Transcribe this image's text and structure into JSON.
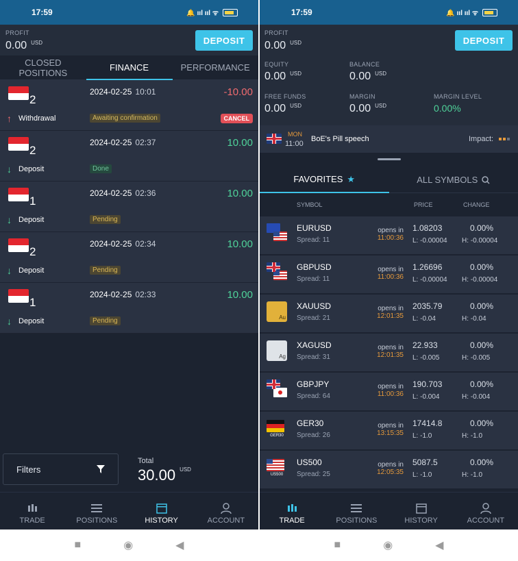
{
  "status": {
    "time": "17:59",
    "icons": "🔔 ııl ııl ᯤ"
  },
  "left": {
    "profit": {
      "label": "PROFIT",
      "value": "0.00",
      "currency": "USD"
    },
    "deposit_btn": "DEPOSIT",
    "tabs": [
      "CLOSED POSITIONS",
      "FINANCE",
      "PERFORMANCE"
    ],
    "rows": [
      {
        "num": "2",
        "date": "2024-02-25",
        "time": "10:01",
        "amount": "-10.00",
        "type": "Withdrawal",
        "status": "Awaiting confirmation",
        "cancel": "CANCEL",
        "amount_color": "#f06b6f"
      },
      {
        "num": "2",
        "date": "2024-02-25",
        "time": "02:37",
        "amount": "10.00",
        "type": "Deposit",
        "status": "Done",
        "amount_color": "#4fd39a"
      },
      {
        "num": "1",
        "date": "2024-02-25",
        "time": "02:36",
        "amount": "10.00",
        "type": "Deposit",
        "status": "Pending",
        "amount_color": "#4fd39a"
      },
      {
        "num": "2",
        "date": "2024-02-25",
        "time": "02:34",
        "amount": "10.00",
        "type": "Deposit",
        "status": "Pending",
        "amount_color": "#4fd39a"
      },
      {
        "num": "1",
        "date": "2024-02-25",
        "time": "02:33",
        "amount": "10.00",
        "type": "Deposit",
        "status": "Pending",
        "amount_color": "#4fd39a"
      }
    ],
    "filters": "Filters",
    "total": {
      "label": "Total",
      "value": "30.00",
      "currency": "USD"
    },
    "nav": [
      "TRADE",
      "POSITIONS",
      "HISTORY",
      "ACCOUNT"
    ]
  },
  "right": {
    "profit": {
      "label": "PROFIT",
      "value": "0.00",
      "currency": "USD"
    },
    "deposit_btn": "DEPOSIT",
    "equity": {
      "label": "EQUITY",
      "value": "0.00",
      "currency": "USD"
    },
    "balance": {
      "label": "BALANCE",
      "value": "0.00",
      "currency": "USD"
    },
    "free_funds": {
      "label": "FREE FUNDS",
      "value": "0.00",
      "currency": "USD"
    },
    "margin": {
      "label": "MARGIN",
      "value": "0.00",
      "currency": "USD"
    },
    "margin_level": {
      "label": "MARGIN LEVEL",
      "value": "0.00%"
    },
    "event": {
      "day": "MON",
      "time": "11:00",
      "title": "BoE's Pill speech",
      "impact": "Impact:"
    },
    "tabs": [
      "FAVORITES",
      "ALL SYMBOLS"
    ],
    "headers": [
      "SYMBOL",
      "PRICE",
      "CHANGE"
    ],
    "symbols": [
      {
        "name": "EURUSD",
        "spread": "Spread: 11",
        "opens": "opens in",
        "otime": "11:00:36",
        "price": "1.08203",
        "low": "L: -0.00004",
        "change": "0.00%",
        "high": "H: -0.00004"
      },
      {
        "name": "GBPUSD",
        "spread": "Spread: 11",
        "opens": "opens in",
        "otime": "11:00:36",
        "price": "1.26696",
        "low": "L: -0.00004",
        "change": "0.00%",
        "high": "H: -0.00004"
      },
      {
        "name": "XAUUSD",
        "spread": "Spread: 21",
        "opens": "opens in",
        "otime": "12:01:35",
        "price": "2035.79",
        "low": "L: -0.04",
        "change": "0.00%",
        "high": "H: -0.04"
      },
      {
        "name": "XAGUSD",
        "spread": "Spread: 31",
        "opens": "opens in",
        "otime": "12:01:35",
        "price": "22.933",
        "low": "L: -0.005",
        "change": "0.00%",
        "high": "H: -0.005"
      },
      {
        "name": "GBPJPY",
        "spread": "Spread: 64",
        "opens": "opens in",
        "otime": "11:00:36",
        "price": "190.703",
        "low": "L: -0.004",
        "change": "0.00%",
        "high": "H: -0.004"
      },
      {
        "name": "GER30",
        "spread": "Spread: 26",
        "opens": "opens in",
        "otime": "13:15:35",
        "price": "17414.8",
        "low": "L: -1.0",
        "change": "0.00%",
        "high": "H: -1.0"
      },
      {
        "name": "US500",
        "spread": "Spread: 25",
        "opens": "opens in",
        "otime": "12:05:35",
        "price": "5087.5",
        "low": "L: -1.0",
        "change": "0.00%",
        "high": "H: -1.0"
      }
    ],
    "icon_labels": {
      "gold": "Au",
      "silver": "Ag",
      "ger": "GER30",
      "us": "US500"
    },
    "nav": [
      "TRADE",
      "POSITIONS",
      "HISTORY",
      "ACCOUNT"
    ]
  }
}
